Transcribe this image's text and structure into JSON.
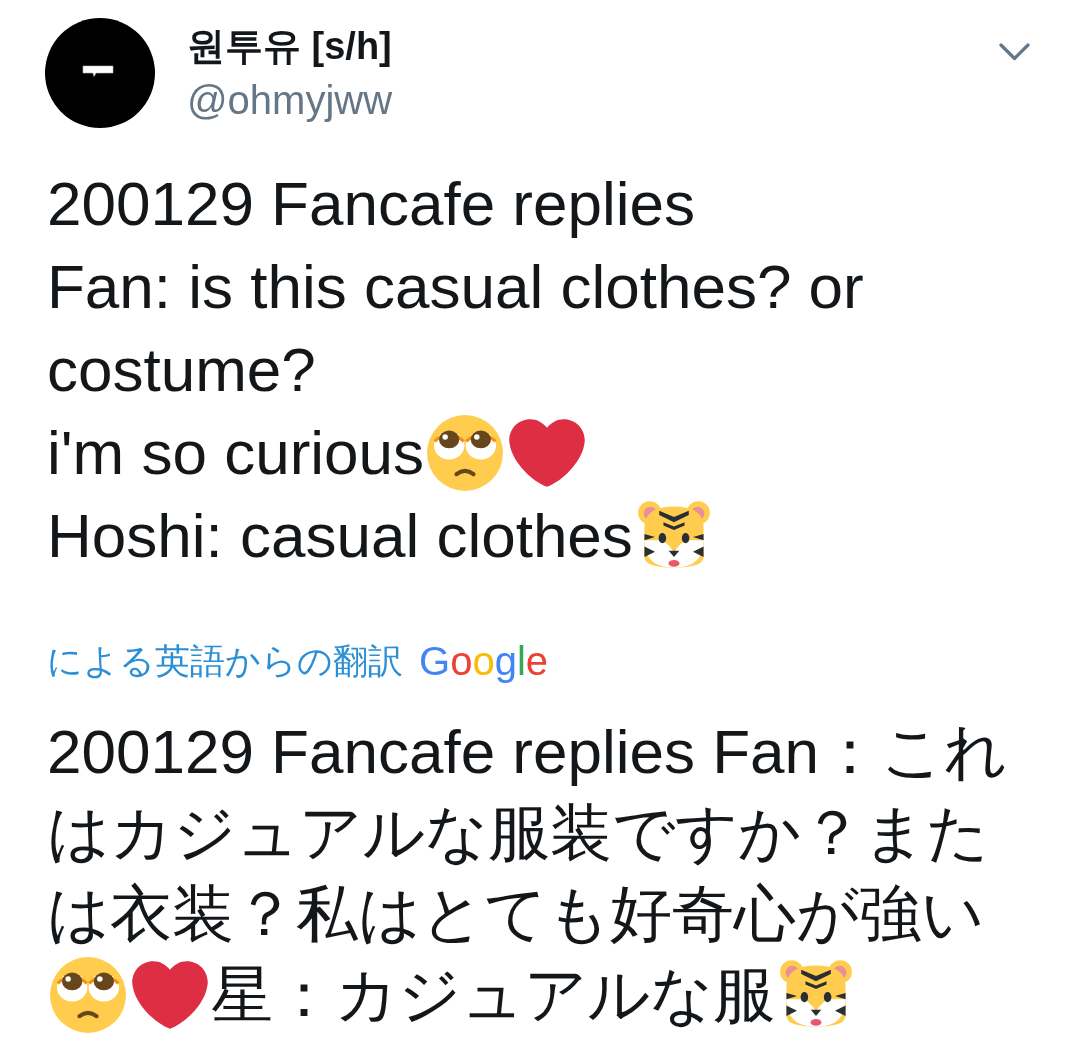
{
  "author": {
    "name": "원투유 [s/h]",
    "handle": "@ohmyjww"
  },
  "tweet": {
    "lines": [
      [
        {
          "kind": "text",
          "text": "200129 Fancafe replies"
        }
      ],
      [
        {
          "kind": "text",
          "text": "Fan: is this casual clothes? or"
        }
      ],
      [
        {
          "kind": "text",
          "text": "costume?"
        }
      ],
      [
        {
          "kind": "text",
          "text": "i'm so curious"
        },
        {
          "kind": "pleading"
        },
        {
          "kind": "heart"
        }
      ],
      [
        {
          "kind": "text",
          "text": "Hoshi: casual clothes"
        },
        {
          "kind": "tiger"
        }
      ]
    ]
  },
  "translation": {
    "label": "による英語からの翻訳",
    "provider": "Google",
    "lines": [
      [
        {
          "kind": "text",
          "text": "200129 Fancafe replies Fan：これ"
        }
      ],
      [
        {
          "kind": "text",
          "text": "はカジュアルな服装ですか？また"
        }
      ],
      [
        {
          "kind": "text",
          "text": "は衣装？私はとても好奇心が強い"
        }
      ],
      [
        {
          "kind": "pleading"
        },
        {
          "kind": "heart"
        },
        {
          "kind": "text",
          "text": "星：カジュアルな服"
        },
        {
          "kind": "tiger"
        }
      ]
    ]
  }
}
